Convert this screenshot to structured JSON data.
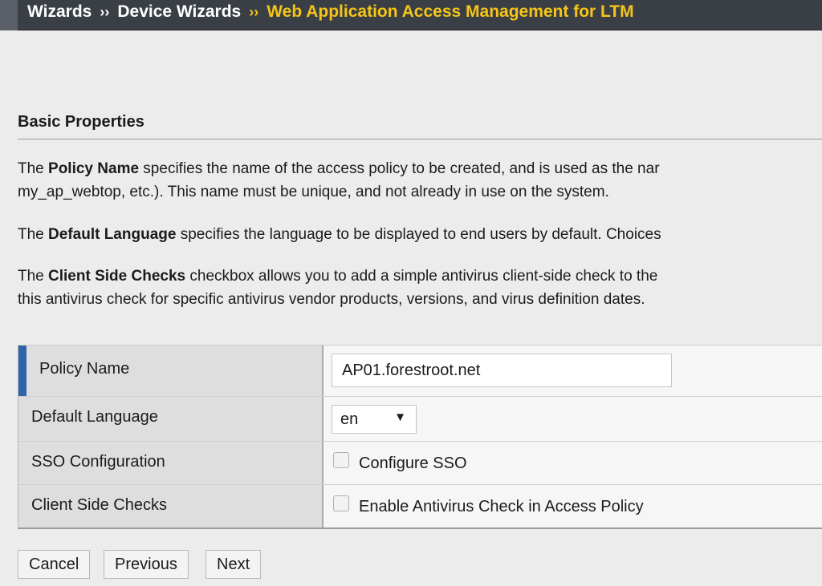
{
  "breadcrumb": {
    "items": [
      "Wizards",
      "Device Wizards",
      "Web Application Access Management for LTM"
    ],
    "separator": "››"
  },
  "section": {
    "title": "Basic Properties"
  },
  "descriptions": {
    "policy_name": {
      "pre": "The ",
      "bold": "Policy Name",
      "post": " specifies the name of the access policy to be created, and is used as the nar",
      "line2": "my_ap_webtop, etc.). This name must be unique, and not already in use on the system."
    },
    "default_language": {
      "pre": "The ",
      "bold": "Default Language",
      "post": " specifies the language to be displayed to end users by default. Choices"
    },
    "client_side_checks": {
      "pre": "The ",
      "bold": "Client Side Checks",
      "post": " checkbox allows you to add a simple antivirus client-side check to the",
      "line2": "this antivirus check for specific antivirus vendor products, versions, and virus definition dates."
    }
  },
  "form": {
    "policy_name": {
      "label": "Policy Name",
      "value": "AP01.forestroot.net"
    },
    "default_language": {
      "label": "Default Language",
      "value": "en"
    },
    "sso_configuration": {
      "label": "SSO Configuration",
      "option": "Configure SSO",
      "checked": false
    },
    "client_side_checks": {
      "label": "Client Side Checks",
      "option": "Enable Antivirus Check in Access Policy",
      "checked": false
    }
  },
  "buttons": {
    "cancel": "Cancel",
    "previous": "Previous",
    "next": "Next"
  },
  "colors": {
    "header_bg": "#3a3f45",
    "breadcrumb_active": "#f5c518",
    "row_accent": "#2f65a8"
  }
}
